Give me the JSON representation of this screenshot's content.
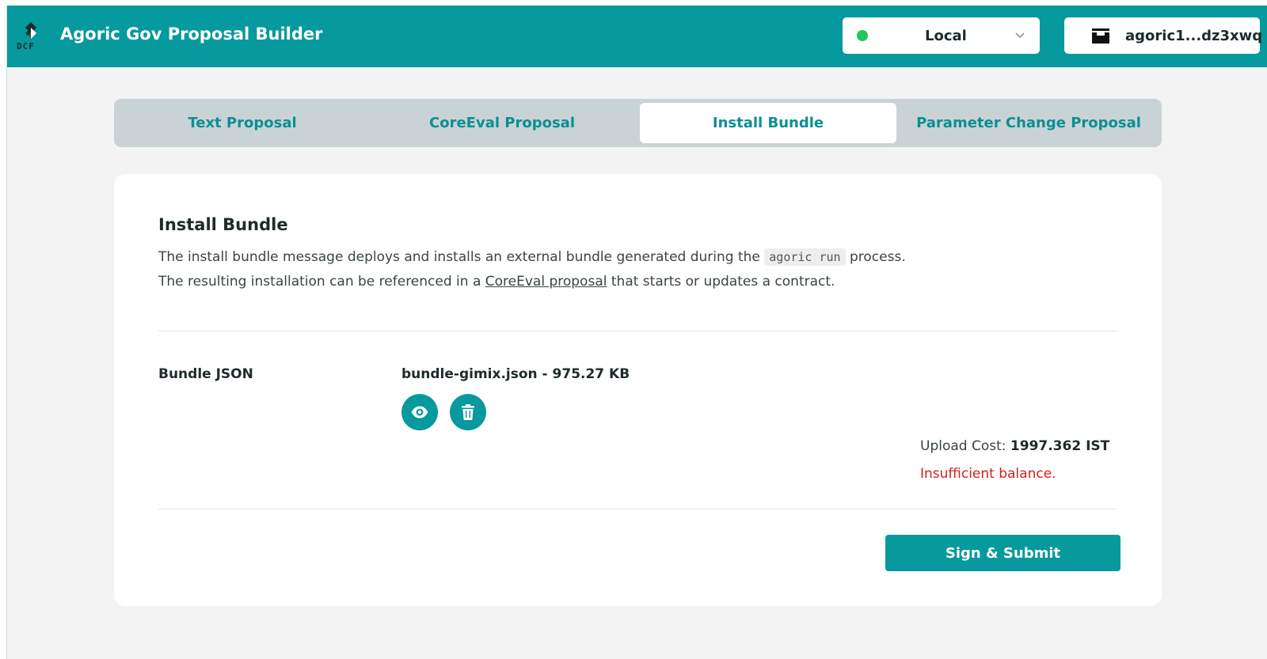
{
  "header": {
    "logo_text": "DCF",
    "title": "Agoric Gov Proposal Builder",
    "network": {
      "label": "Local",
      "status_color": "#22c55e"
    },
    "wallet": {
      "label": "agoric1...dz3xwq",
      "icon": "wallet-icon"
    }
  },
  "tabs": [
    {
      "label": "Text Proposal",
      "active": false
    },
    {
      "label": "CoreEval Proposal",
      "active": false
    },
    {
      "label": "Install Bundle",
      "active": true
    },
    {
      "label": "Parameter Change Proposal",
      "active": false
    }
  ],
  "section": {
    "title": "Install Bundle",
    "desc_part1": "The install bundle message deploys and installs an external bundle generated during the ",
    "desc_code": "agoric run",
    "desc_part2": " process. The resulting installation can be referenced in a ",
    "desc_link": "CoreEval proposal",
    "desc_part3": " that starts or updates a contract."
  },
  "bundle": {
    "label": "Bundle JSON",
    "file_name": "bundle-gimix.json - 975.27 KB",
    "view_icon": "eye-icon",
    "delete_icon": "trash-icon"
  },
  "cost": {
    "label": "Upload Cost: ",
    "value": "1997.362 IST",
    "error": "Insufficient balance."
  },
  "submit_label": "Sign & Submit",
  "colors": {
    "brand": "#06999d",
    "error": "#d02020",
    "tab_bg": "#c9d3d6"
  }
}
